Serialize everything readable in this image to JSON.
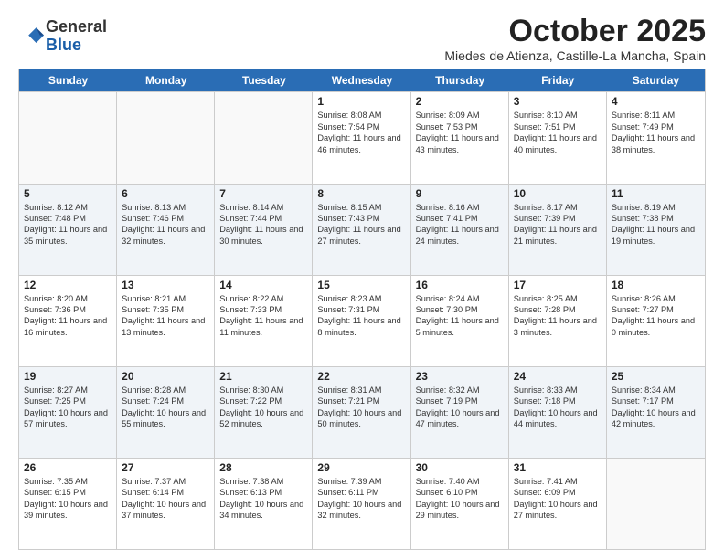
{
  "logo": {
    "general": "General",
    "blue": "Blue"
  },
  "title": "October 2025",
  "subtitle": "Miedes de Atienza, Castille-La Mancha, Spain",
  "days_of_week": [
    "Sunday",
    "Monday",
    "Tuesday",
    "Wednesday",
    "Thursday",
    "Friday",
    "Saturday"
  ],
  "weeks": [
    [
      {
        "day": "",
        "text": ""
      },
      {
        "day": "",
        "text": ""
      },
      {
        "day": "",
        "text": ""
      },
      {
        "day": "1",
        "text": "Sunrise: 8:08 AM\nSunset: 7:54 PM\nDaylight: 11 hours and 46 minutes."
      },
      {
        "day": "2",
        "text": "Sunrise: 8:09 AM\nSunset: 7:53 PM\nDaylight: 11 hours and 43 minutes."
      },
      {
        "day": "3",
        "text": "Sunrise: 8:10 AM\nSunset: 7:51 PM\nDaylight: 11 hours and 40 minutes."
      },
      {
        "day": "4",
        "text": "Sunrise: 8:11 AM\nSunset: 7:49 PM\nDaylight: 11 hours and 38 minutes."
      }
    ],
    [
      {
        "day": "5",
        "text": "Sunrise: 8:12 AM\nSunset: 7:48 PM\nDaylight: 11 hours and 35 minutes."
      },
      {
        "day": "6",
        "text": "Sunrise: 8:13 AM\nSunset: 7:46 PM\nDaylight: 11 hours and 32 minutes."
      },
      {
        "day": "7",
        "text": "Sunrise: 8:14 AM\nSunset: 7:44 PM\nDaylight: 11 hours and 30 minutes."
      },
      {
        "day": "8",
        "text": "Sunrise: 8:15 AM\nSunset: 7:43 PM\nDaylight: 11 hours and 27 minutes."
      },
      {
        "day": "9",
        "text": "Sunrise: 8:16 AM\nSunset: 7:41 PM\nDaylight: 11 hours and 24 minutes."
      },
      {
        "day": "10",
        "text": "Sunrise: 8:17 AM\nSunset: 7:39 PM\nDaylight: 11 hours and 21 minutes."
      },
      {
        "day": "11",
        "text": "Sunrise: 8:19 AM\nSunset: 7:38 PM\nDaylight: 11 hours and 19 minutes."
      }
    ],
    [
      {
        "day": "12",
        "text": "Sunrise: 8:20 AM\nSunset: 7:36 PM\nDaylight: 11 hours and 16 minutes."
      },
      {
        "day": "13",
        "text": "Sunrise: 8:21 AM\nSunset: 7:35 PM\nDaylight: 11 hours and 13 minutes."
      },
      {
        "day": "14",
        "text": "Sunrise: 8:22 AM\nSunset: 7:33 PM\nDaylight: 11 hours and 11 minutes."
      },
      {
        "day": "15",
        "text": "Sunrise: 8:23 AM\nSunset: 7:31 PM\nDaylight: 11 hours and 8 minutes."
      },
      {
        "day": "16",
        "text": "Sunrise: 8:24 AM\nSunset: 7:30 PM\nDaylight: 11 hours and 5 minutes."
      },
      {
        "day": "17",
        "text": "Sunrise: 8:25 AM\nSunset: 7:28 PM\nDaylight: 11 hours and 3 minutes."
      },
      {
        "day": "18",
        "text": "Sunrise: 8:26 AM\nSunset: 7:27 PM\nDaylight: 11 hours and 0 minutes."
      }
    ],
    [
      {
        "day": "19",
        "text": "Sunrise: 8:27 AM\nSunset: 7:25 PM\nDaylight: 10 hours and 57 minutes."
      },
      {
        "day": "20",
        "text": "Sunrise: 8:28 AM\nSunset: 7:24 PM\nDaylight: 10 hours and 55 minutes."
      },
      {
        "day": "21",
        "text": "Sunrise: 8:30 AM\nSunset: 7:22 PM\nDaylight: 10 hours and 52 minutes."
      },
      {
        "day": "22",
        "text": "Sunrise: 8:31 AM\nSunset: 7:21 PM\nDaylight: 10 hours and 50 minutes."
      },
      {
        "day": "23",
        "text": "Sunrise: 8:32 AM\nSunset: 7:19 PM\nDaylight: 10 hours and 47 minutes."
      },
      {
        "day": "24",
        "text": "Sunrise: 8:33 AM\nSunset: 7:18 PM\nDaylight: 10 hours and 44 minutes."
      },
      {
        "day": "25",
        "text": "Sunrise: 8:34 AM\nSunset: 7:17 PM\nDaylight: 10 hours and 42 minutes."
      }
    ],
    [
      {
        "day": "26",
        "text": "Sunrise: 7:35 AM\nSunset: 6:15 PM\nDaylight: 10 hours and 39 minutes."
      },
      {
        "day": "27",
        "text": "Sunrise: 7:37 AM\nSunset: 6:14 PM\nDaylight: 10 hours and 37 minutes."
      },
      {
        "day": "28",
        "text": "Sunrise: 7:38 AM\nSunset: 6:13 PM\nDaylight: 10 hours and 34 minutes."
      },
      {
        "day": "29",
        "text": "Sunrise: 7:39 AM\nSunset: 6:11 PM\nDaylight: 10 hours and 32 minutes."
      },
      {
        "day": "30",
        "text": "Sunrise: 7:40 AM\nSunset: 6:10 PM\nDaylight: 10 hours and 29 minutes."
      },
      {
        "day": "31",
        "text": "Sunrise: 7:41 AM\nSunset: 6:09 PM\nDaylight: 10 hours and 27 minutes."
      },
      {
        "day": "",
        "text": ""
      }
    ]
  ]
}
